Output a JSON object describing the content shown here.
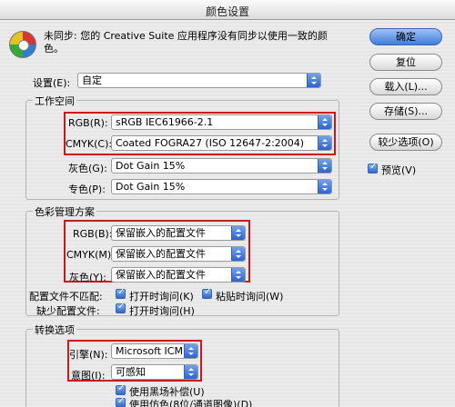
{
  "window": {
    "title": "颜色设置"
  },
  "message": "未同步: 您的 Creative Suite 应用程序没有同步以使用一致的颜色。",
  "settings": {
    "label": "设置(E):",
    "value": "自定"
  },
  "working_spaces": {
    "title": "工作空间",
    "rgb": {
      "label": "RGB(R):",
      "value": "sRGB IEC61966-2.1"
    },
    "cmyk": {
      "label": "CMYK(C):",
      "value": "Coated FOGRA27 (ISO 12647-2:2004)"
    },
    "gray": {
      "label": "灰色(G):",
      "value": "Dot Gain 15%"
    },
    "spot": {
      "label": "专色(P):",
      "value": "Dot Gain 15%"
    }
  },
  "policies": {
    "title": "色彩管理方案",
    "rgb": {
      "label": "RGB(B):",
      "value": "保留嵌入的配置文件"
    },
    "cmyk": {
      "label": "CMYK(M):",
      "value": "保留嵌入的配置文件"
    },
    "gray": {
      "label": "灰色(Y):",
      "value": "保留嵌入的配置文件"
    },
    "mismatch_label": "配置文件不匹配:",
    "ask_open": "打开时询问(K)",
    "ask_paste": "粘贴时询问(W)",
    "missing_label": "缺少配置文件:",
    "ask_open_missing": "打开时询问(H)"
  },
  "conversion": {
    "title": "转换选项",
    "engine": {
      "label": "引擎(N):",
      "value": "Microsoft ICM"
    },
    "intent": {
      "label": "意图(I):",
      "value": "可感知"
    },
    "bpc": "使用黑场补偿(U)",
    "dither": "使用仿色(8位/通道图像)(D)"
  },
  "buttons": {
    "ok": "确定",
    "reset": "复位",
    "load": "载入(L)...",
    "save": "存储(S)...",
    "fewer": "较少选项(O)"
  },
  "preview": "预览(V)"
}
